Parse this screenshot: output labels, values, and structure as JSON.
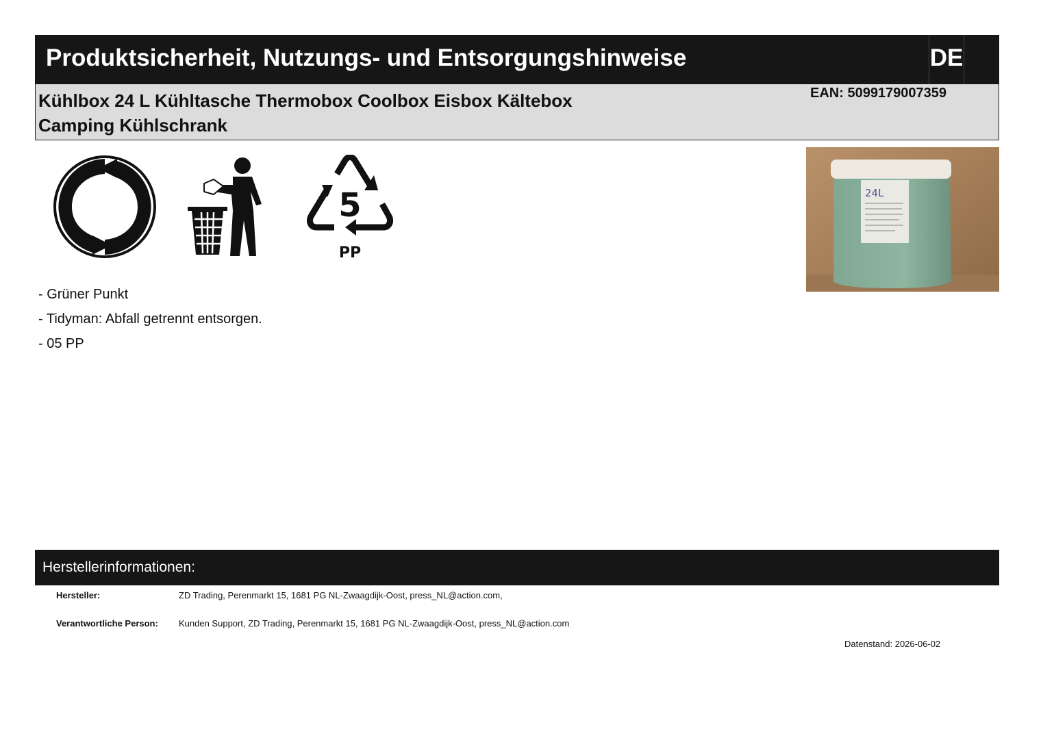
{
  "header": {
    "title": "Produktsicherheit, Nutzungs- und Entsorgungshinweise",
    "lang": "DE"
  },
  "product": {
    "name": "Kühlbox 24 L Kühltasche Thermobox Coolbox Eisbox Kältebox Camping Kühlschrank",
    "ean": "EAN: 5099179007359"
  },
  "symbols": {
    "recycling_code": "5",
    "recycling_material": "PP"
  },
  "photo": {
    "label": "24L"
  },
  "notes": [
    "- Grüner Punkt",
    "- Tidyman: Abfall getrennt entsorgen.",
    "- 05 PP"
  ],
  "manufacturer": {
    "section_title": "Herstellerinformationen:",
    "manufacturer_label": "Hersteller:",
    "manufacturer_value": "ZD Trading, Perenmarkt 15, 1681 PG  NL-Zwaagdijk-Oost, press_NL@action.com,",
    "responsible_label": "Verantwortliche Person:",
    "responsible_value": "Kunden Support, ZD Trading, Perenmarkt 15, 1681 PG  NL-Zwaagdijk-Oost, press_NL@action.com"
  },
  "footer": {
    "date": "Datenstand: 2026-06-02"
  }
}
